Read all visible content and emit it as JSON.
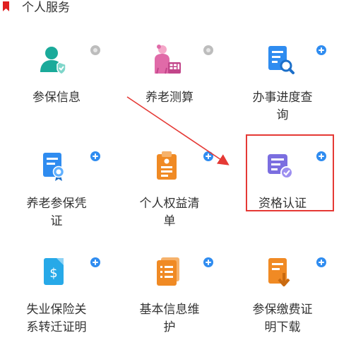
{
  "header": {
    "title": "个人服务",
    "icon": "bookmark-icon",
    "icon_color": "#e02020"
  },
  "services": [
    {
      "label": "参保信息",
      "icon": "person-shield-icon",
      "badge": "dot"
    },
    {
      "label": "养老测算",
      "icon": "elder-calculator-icon",
      "badge": "dot"
    },
    {
      "label": "办事进度查\n询",
      "icon": "document-search-icon",
      "badge": "plus"
    },
    {
      "label": "养老参保凭\n证",
      "icon": "certificate-icon",
      "badge": "plus"
    },
    {
      "label": "个人权益清\n单",
      "icon": "clipboard-list-icon",
      "badge": "plus"
    },
    {
      "label": "资格认证",
      "icon": "verified-document-icon",
      "badge": "plus"
    },
    {
      "label": "失业保险关\n系转迁证明",
      "icon": "transfer-document-icon",
      "badge": "plus"
    },
    {
      "label": "基本信息维\n护",
      "icon": "info-pages-icon",
      "badge": "plus"
    },
    {
      "label": "参保缴费证\n明下载",
      "icon": "download-document-icon",
      "badge": "plus"
    }
  ],
  "annotation": {
    "highlighted_item": "资格认证",
    "color": "#e53935"
  },
  "colors": {
    "teal": "#1aaa9a",
    "pink": "#e06aa8",
    "blue": "#2f8cf0",
    "orange": "#f08a24",
    "purple": "#7b6ee0",
    "cyan": "#27a9e8"
  }
}
